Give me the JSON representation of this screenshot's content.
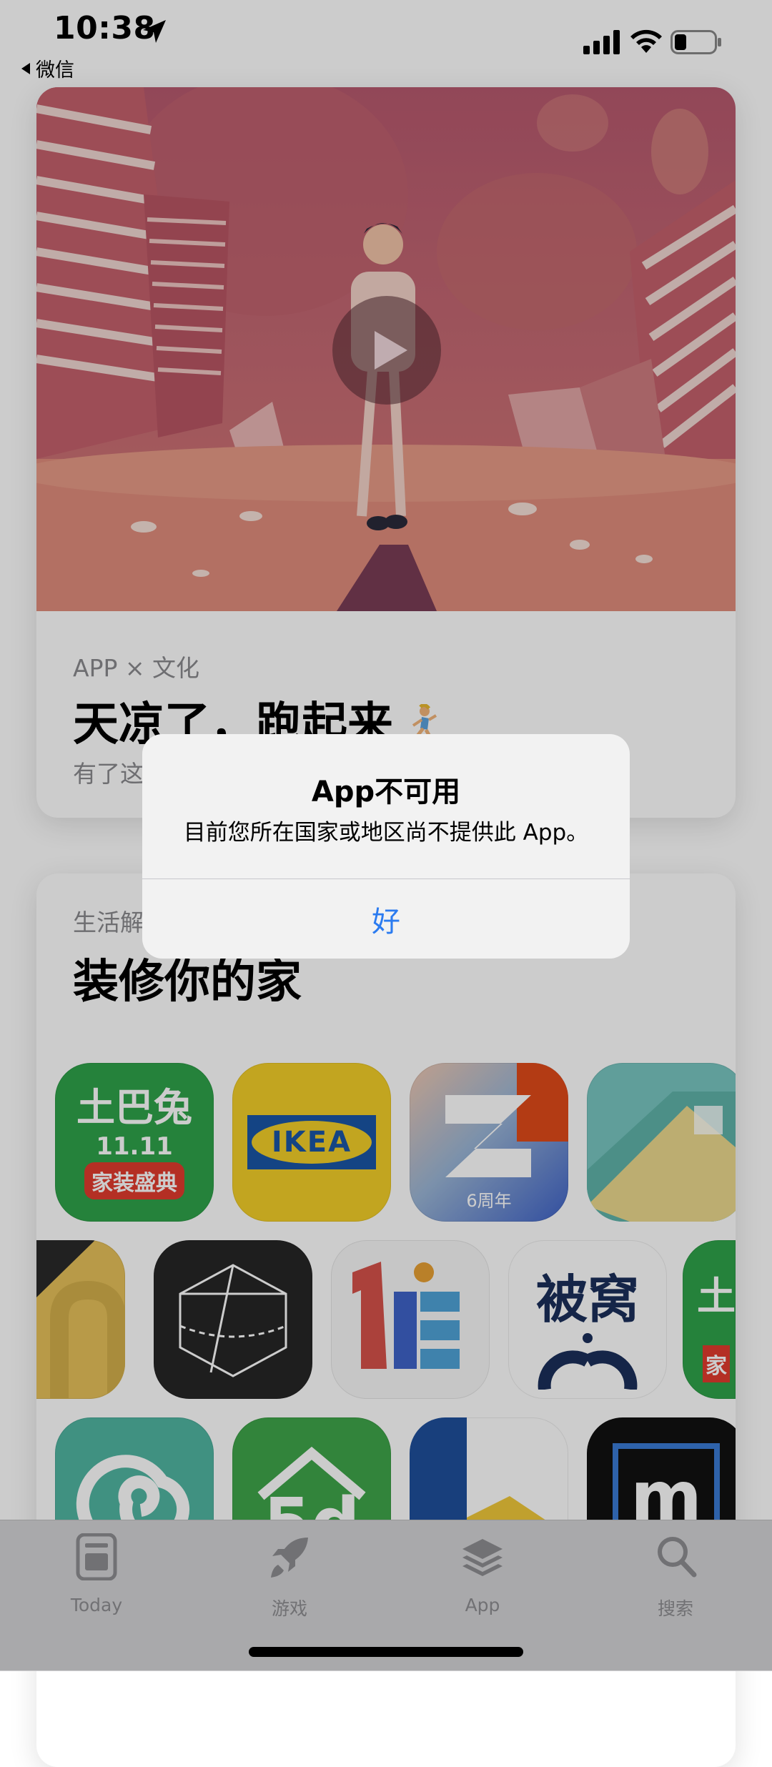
{
  "status_bar": {
    "time": "10:38",
    "back_app": "微信"
  },
  "cards": [
    {
      "category": "APP × 文化",
      "title": "天凉了，跑起来",
      "description_visible": "有了这"
    },
    {
      "category": "生活解",
      "title": "装修你的家"
    }
  ],
  "app_icons": {
    "row1": [
      {
        "name": "土巴兔",
        "lines": [
          "土巴兔",
          "11.11",
          "家装盛典"
        ],
        "bg": "#2fa34a"
      },
      {
        "name": "IKEA",
        "lines": [
          "IKEA"
        ],
        "bg": "#f3cf28"
      },
      {
        "name": "6周年",
        "lines": [
          "6周年"
        ],
        "bg": "#7d9fc7"
      },
      {
        "name": "house",
        "lines": [],
        "bg": "#78c6c1"
      }
    ],
    "row2": [
      {
        "name": "partial-yellow",
        "lines": [],
        "bg": "#e6c15a"
      },
      {
        "name": "cube",
        "lines": [],
        "bg": "#262626"
      },
      {
        "name": "1E",
        "lines": [],
        "bg": "#f8f8f8"
      },
      {
        "name": "被窝",
        "lines": [
          "被窝"
        ],
        "bg": "#ffffff"
      },
      {
        "name": "土巴兔-partial",
        "lines": [
          "土",
          "家"
        ],
        "bg": "#2fa34a"
      }
    ],
    "row3": [
      {
        "name": "spiral",
        "lines": [],
        "bg": "#50b6a2"
      },
      {
        "name": "5d",
        "lines": [
          "5d"
        ],
        "bg": "#3fa64a"
      },
      {
        "name": "blue-yellow",
        "lines": [],
        "bg": "#ffffff"
      },
      {
        "name": "m",
        "lines": [
          "m"
        ],
        "bg": "#111111"
      }
    ]
  },
  "alert": {
    "title": "App不可用",
    "message": "目前您所在国家或地区尚不提供此 App。",
    "button": "好"
  },
  "tab_bar": {
    "tabs": [
      {
        "label": "Today",
        "icon": "today-icon"
      },
      {
        "label": "游戏",
        "icon": "rocket-icon"
      },
      {
        "label": "App",
        "icon": "layers-icon"
      },
      {
        "label": "搜索",
        "icon": "search-icon"
      }
    ]
  },
  "colors": {
    "alert_button": "#2b7bf0",
    "tab_inactive": "#8e8e92"
  }
}
